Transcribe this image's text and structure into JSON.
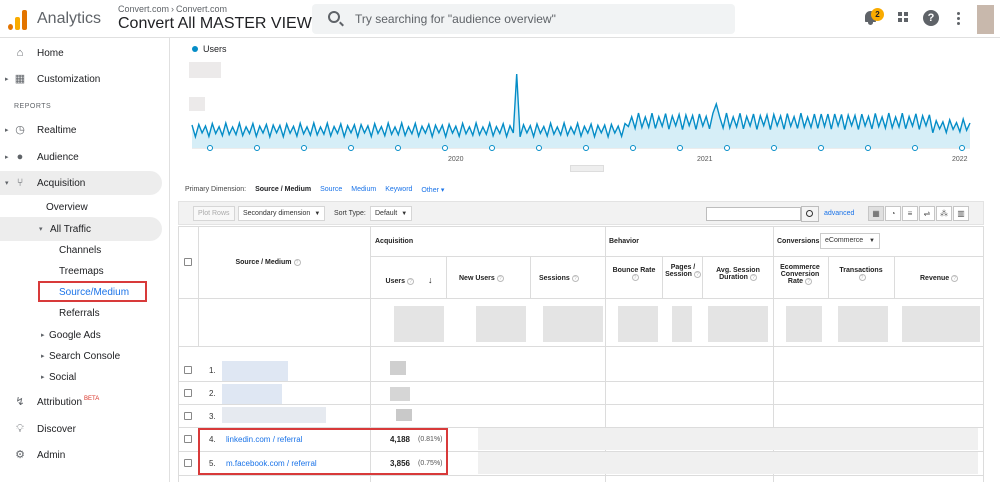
{
  "app": {
    "name": "Analytics"
  },
  "account": {
    "breadcrumb": [
      "Convert.com",
      "Convert.com"
    ],
    "view": "Convert All MASTER VIEW"
  },
  "search": {
    "placeholder": "Try searching for \"audience overview\""
  },
  "notifications": {
    "count": "2"
  },
  "colors": {
    "accent": "#1a73e8",
    "series": "#058dc7",
    "highlight": "#d83a3a",
    "logo_orange": "#e37400",
    "logo_yellow": "#f9ab00"
  },
  "icons": [
    "search-icon",
    "bell-icon",
    "apps-grid-icon",
    "help-icon",
    "more-vert-icon"
  ],
  "sidebar": {
    "home": "Home",
    "customization": "Customization",
    "reports_header": "REPORTS",
    "realtime": "Realtime",
    "audience": "Audience",
    "acquisition": "Acquisition",
    "overview": "Overview",
    "all_traffic": "All Traffic",
    "channels": "Channels",
    "treemaps": "Treemaps",
    "source_medium": "Source/Medium",
    "referrals": "Referrals",
    "google_ads": "Google Ads",
    "search_console": "Search Console",
    "social": "Social",
    "attribution": "Attribution",
    "attribution_badge": "BETA",
    "discover": "Discover",
    "admin": "Admin"
  },
  "chart": {
    "legend": "Users",
    "x_labels": [
      "2020",
      "2021",
      "2022"
    ]
  },
  "dimension_bar": {
    "label": "Primary Dimension:",
    "current": "Source / Medium",
    "options": [
      "Source",
      "Medium",
      "Keyword",
      "Other"
    ]
  },
  "toolbar": {
    "plot_rows": "Plot Rows",
    "secondary_dimension": "Secondary dimension",
    "sort_type_label": "Sort Type:",
    "sort_type_value": "Default",
    "advanced": "advanced"
  },
  "table": {
    "dimension_header": "Source / Medium",
    "groups": {
      "acquisition": "Acquisition",
      "behavior": "Behavior",
      "conversions": "Conversions",
      "conversions_select": "eCommerce"
    },
    "columns": {
      "users": "Users",
      "new_users": "New Users",
      "sessions": "Sessions",
      "bounce_rate": "Bounce Rate",
      "pages_session": "Pages / Session",
      "avg_session": "Avg. Session Duration",
      "ecom_rate": "Ecommerce Conversion Rate",
      "transactions": "Transactions",
      "revenue": "Revenue"
    },
    "rows": [
      {
        "index": "1.",
        "source": "",
        "users": "",
        "pct": ""
      },
      {
        "index": "2.",
        "source": "",
        "users": "",
        "pct": ""
      },
      {
        "index": "3.",
        "source": "",
        "users": "",
        "pct": ""
      },
      {
        "index": "4.",
        "source": "linkedin.com / referral",
        "users": "4,188",
        "pct": "(0.81%)"
      },
      {
        "index": "5.",
        "source": "m.facebook.com / referral",
        "users": "3,856",
        "pct": "(0.75%)"
      }
    ]
  }
}
